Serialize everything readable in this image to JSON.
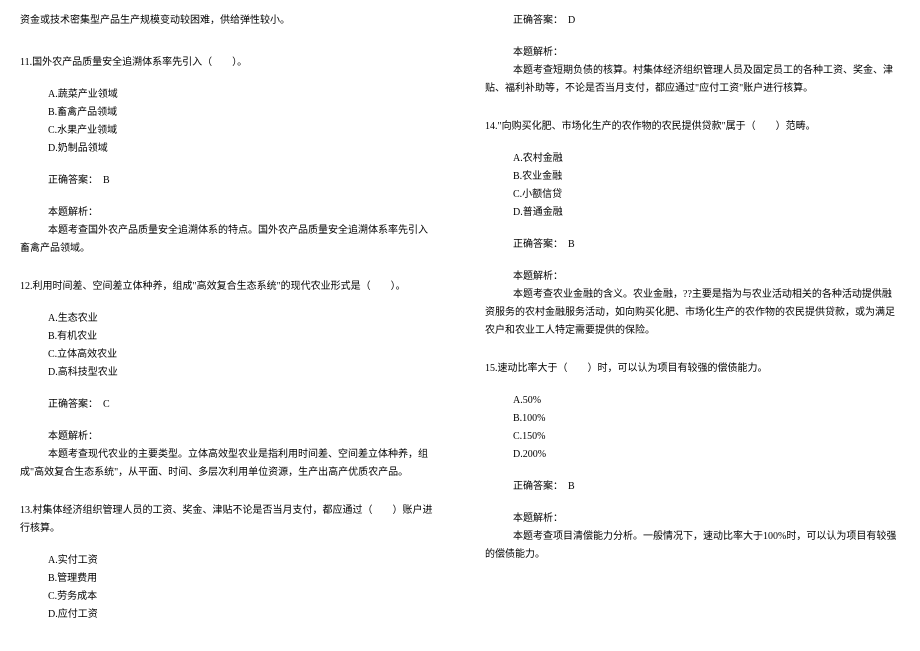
{
  "intro": "资金或技术密集型产品生产规模变动较困难，供给弹性较小。",
  "q11": {
    "text": "11.国外农产品质量安全追溯体系率先引入（　　）。",
    "options": {
      "a": "A.蔬菜产业领域",
      "b": "B.畜禽产品领域",
      "c": "C.水果产业领域",
      "d": "D.奶制品领域"
    },
    "answer": "正确答案：　B",
    "explain_label": "本题解析：",
    "explain": "本题考查国外农产品质量安全追溯体系的特点。国外农产品质量安全追溯体系率先引入畜禽产品领域。"
  },
  "q12": {
    "text": "12.利用时间差、空间差立体种养，组成\"高效复合生态系统\"的现代农业形式是（　　）。",
    "options": {
      "a": "A.生态农业",
      "b": "B.有机农业",
      "c": "C.立体高效农业",
      "d": "D.高科技型农业"
    },
    "answer": "正确答案：　C",
    "explain_label": "本题解析：",
    "explain": "本题考查现代农业的主要类型。立体高效型农业是指利用时间差、空间差立体种养，组成\"高效复合生态系统\"，从平面、时间、多层次利用单位资源，生产出高产优质农产品。"
  },
  "q13": {
    "text": "13.村集体经济组织管理人员的工资、奖金、津贴不论是否当月支付，都应通过（　　）账户进行核算。",
    "options": {
      "a": "A.实付工资",
      "b": "B.管理费用",
      "c": "C.劳务成本",
      "d": "D.应付工资"
    },
    "answer": "正确答案：　D",
    "explain_label": "本题解析：",
    "explain": "本题考查短期负债的核算。村集体经济组织管理人员及固定员工的各种工资、奖金、津贴、福利补助等，不论是否当月支付，都应通过\"应付工资\"账户进行核算。"
  },
  "q14": {
    "text": "14.\"向购买化肥、市场化生产的农作物的农民提供贷款\"属于（　　）范畴。",
    "options": {
      "a": "A.农村金融",
      "b": "B.农业金融",
      "c": "C.小额信贷",
      "d": "D.普通金融"
    },
    "answer": "正确答案：　B",
    "explain_label": "本题解析：",
    "explain": "本题考查农业金融的含义。农业金融，??主要是指为与农业活动相关的各种活动提供融资服务的农村金融服务活动，如向购买化肥、市场化生产的农作物的农民提供贷款，或为满足农户和农业工人特定需要提供的保险。"
  },
  "q15": {
    "text": "15.速动比率大于（　　）时，可以认为项目有较强的偿债能力。",
    "options": {
      "a": "A.50%",
      "b": "B.100%",
      "c": "C.150%",
      "d": "D.200%"
    },
    "answer": "正确答案：　B",
    "explain_label": "本题解析：",
    "explain": "本题考查项目清偿能力分析。一般情况下，速动比率大于100%时，可以认为项目有较强的偿债能力。"
  }
}
